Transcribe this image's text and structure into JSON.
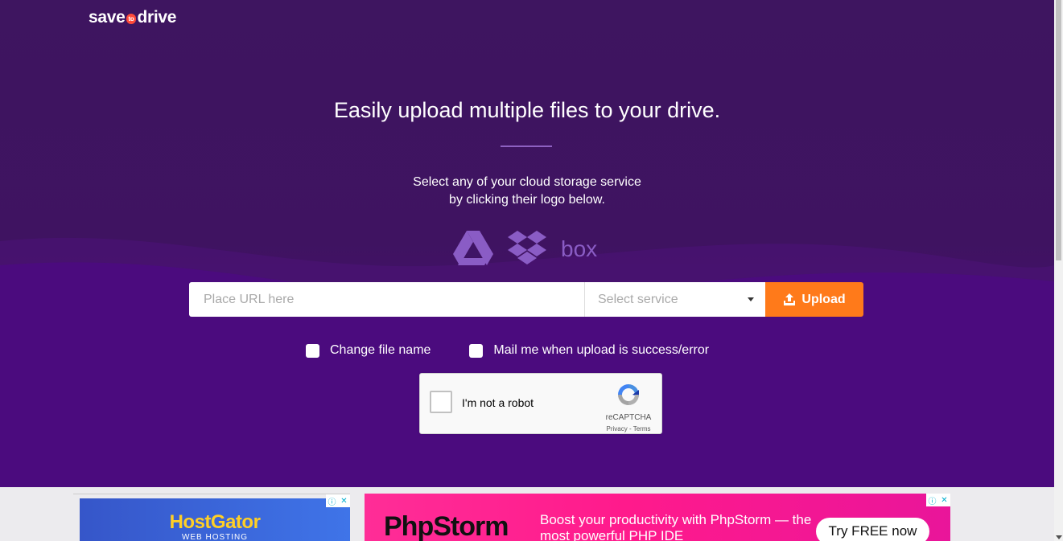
{
  "brand": {
    "name_left": "save",
    "name_badge": "to",
    "name_right": "drive"
  },
  "hero": {
    "headline": "Easily upload multiple files to your drive.",
    "subline_1": "Select any of your cloud storage service",
    "subline_2": "by clicking their logo below.",
    "services": [
      "google-drive",
      "dropbox",
      "box"
    ],
    "box_label": "box"
  },
  "form": {
    "url_placeholder": "Place URL here",
    "service_placeholder": "Select service",
    "upload_label": "Upload"
  },
  "options": {
    "change_name": "Change file name",
    "mail_me": "Mail me when upload is success/error"
  },
  "captcha": {
    "label": "I'm not a robot",
    "brand": "reCAPTCHA",
    "links": "Privacy - Terms"
  },
  "ads": {
    "left": {
      "title": "HostGator",
      "subtitle": "WEB HOSTING"
    },
    "right": {
      "title": "PhpStorm",
      "message": "Boost your productivity with PhpStorm — the most powerful PHP IDE",
      "cta": "Try FREE now"
    },
    "adchoice_info": "ⓘ",
    "adchoice_close": "✕"
  },
  "colors": {
    "hero_bg": "#3e1560",
    "accent": "#ff7a1a",
    "icon": "#8a5cc5",
    "ad_pink": "#ff1a8c",
    "ad_blue": "#3f74e8"
  }
}
